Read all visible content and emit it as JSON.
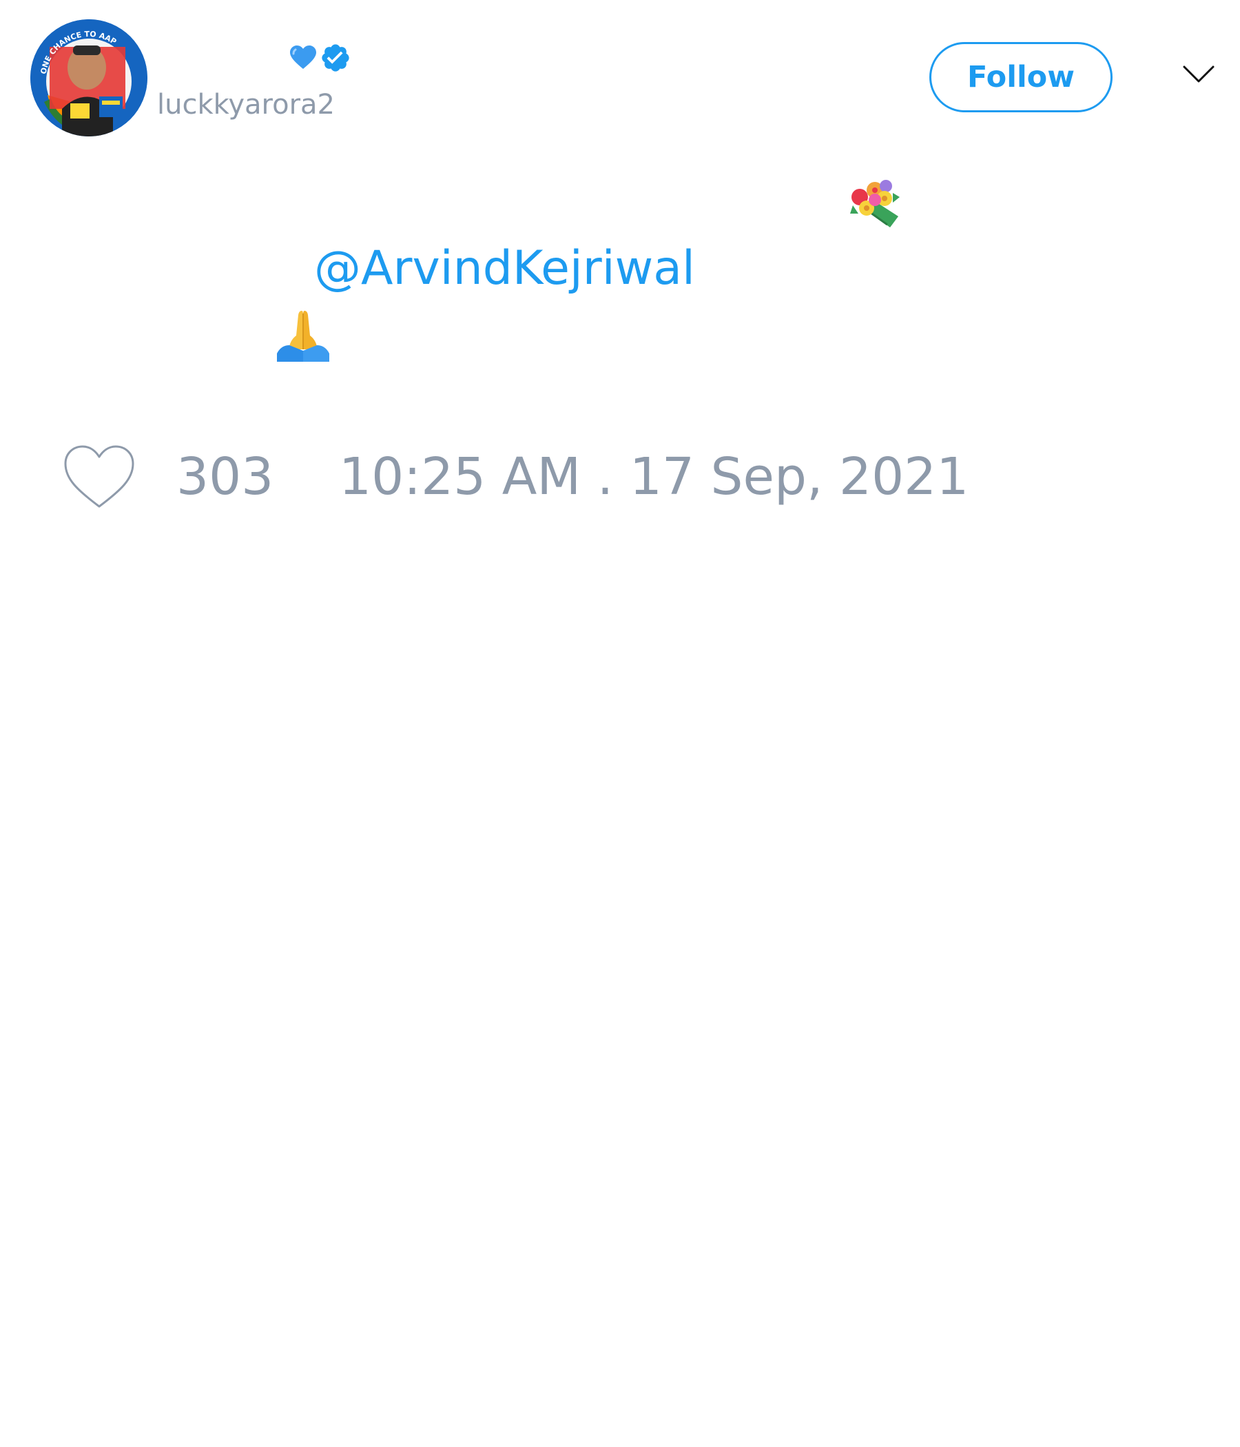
{
  "tweet": {
    "author": {
      "username": "luckkyarora2",
      "name_badge_icon": "blue-heart-icon",
      "verified_icon": "verified-badge-icon",
      "avatar_icon": "profile-photo",
      "avatar_text": "ONE CHANCE TO AAP"
    },
    "follow_label": "Follow",
    "menu_icon": "chevron-down-icon",
    "body": {
      "mention": "@ArvindKejriwal",
      "emojis": [
        "bouquet",
        "folded-hands"
      ]
    },
    "likes": "303",
    "timestamp": "10:25 AM . 17 Sep, 2021"
  },
  "colors": {
    "accent": "#1d9bf0",
    "muted_text": "#8e9aaa",
    "background": "#ffffff"
  }
}
